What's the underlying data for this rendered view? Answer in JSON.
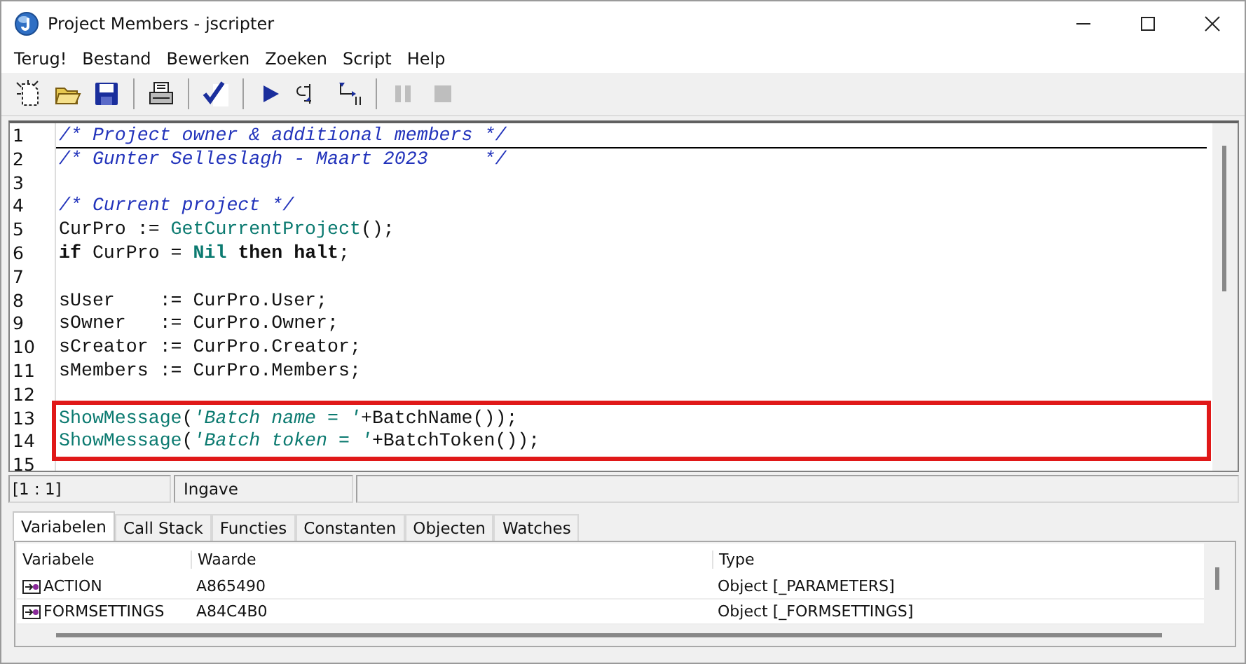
{
  "window": {
    "title": "Project Members - jscripter"
  },
  "menu": [
    "Terug!",
    "Bestand",
    "Bewerken",
    "Zoeken",
    "Script",
    "Help"
  ],
  "toolbar": {
    "groups": [
      [
        {
          "kind": "new",
          "disabled": false
        },
        {
          "kind": "open",
          "disabled": false
        },
        {
          "kind": "save",
          "disabled": false
        }
      ],
      [
        {
          "kind": "print",
          "disabled": false
        }
      ],
      [
        {
          "kind": "check",
          "disabled": false
        }
      ],
      [
        {
          "kind": "run",
          "disabled": false
        },
        {
          "kind": "step-into",
          "disabled": false
        },
        {
          "kind": "step-over",
          "disabled": false
        }
      ],
      [
        {
          "kind": "pause",
          "disabled": true
        },
        {
          "kind": "stop",
          "disabled": true
        }
      ]
    ]
  },
  "editor": {
    "lines": [
      {
        "number": "1",
        "current": true,
        "marked": false,
        "tokens": [
          {
            "kind": "comment",
            "text": "/* Project owner & additional members */"
          }
        ]
      },
      {
        "number": "2",
        "current": false,
        "marked": false,
        "tokens": [
          {
            "kind": "comment",
            "text": "/* Gunter Selleslagh - Maart 2023     */"
          }
        ]
      },
      {
        "number": "3",
        "current": false,
        "marked": false
      },
      {
        "number": "4",
        "current": false,
        "marked": false,
        "tokens": [
          {
            "kind": "comment",
            "text": "/* Current project */"
          }
        ]
      },
      {
        "number": "5",
        "current": false,
        "marked": false,
        "tokens": [
          {
            "kind": "text",
            "text": "CurPro := "
          },
          {
            "kind": "function",
            "text": "GetCurrentProject"
          },
          {
            "kind": "text",
            "text": "();"
          }
        ]
      },
      {
        "number": "6",
        "current": false,
        "marked": false,
        "tokens": [
          {
            "kind": "keyword",
            "text": "if"
          },
          {
            "kind": "text",
            "text": " CurPro = "
          },
          {
            "kind": "constant",
            "text": "Nil"
          },
          {
            "kind": "keyword",
            "text": " then"
          },
          {
            "kind": "keyword",
            "text": " halt"
          },
          {
            "kind": "text",
            "text": ";"
          }
        ]
      },
      {
        "number": "7",
        "current": false,
        "marked": false
      },
      {
        "number": "8",
        "current": false,
        "marked": false,
        "tokens": [
          {
            "kind": "text",
            "text": "sUser    := CurPro.User;"
          }
        ]
      },
      {
        "number": "9",
        "current": false,
        "marked": false,
        "tokens": [
          {
            "kind": "text",
            "text": "sOwner   := CurPro.Owner;"
          }
        ]
      },
      {
        "number": "10",
        "current": false,
        "marked": false,
        "tokens": [
          {
            "kind": "text",
            "text": "sCreator := CurPro.Creator;"
          }
        ]
      },
      {
        "number": "11",
        "current": false,
        "marked": false,
        "tokens": [
          {
            "kind": "text",
            "text": "sMembers := CurPro.Members;"
          }
        ]
      },
      {
        "number": "12",
        "current": false,
        "marked": false
      },
      {
        "number": "13",
        "current": false,
        "marked": true,
        "tokens": [
          {
            "kind": "function",
            "text": "ShowMessage"
          },
          {
            "kind": "text",
            "text": "("
          },
          {
            "kind": "string",
            "text": "'Batch name = '"
          },
          {
            "kind": "text",
            "text": "+BatchName());"
          }
        ]
      },
      {
        "number": "14",
        "current": false,
        "marked": true,
        "tokens": [
          {
            "kind": "function",
            "text": "ShowMessage"
          },
          {
            "kind": "text",
            "text": "("
          },
          {
            "kind": "string",
            "text": "'Batch token = '"
          },
          {
            "kind": "text",
            "text": "+BatchToken());"
          }
        ]
      },
      {
        "number": "15",
        "current": false,
        "marked": false
      }
    ]
  },
  "status_bar": {
    "position": "[1 : 1]",
    "mode": "Ingave"
  },
  "tabs": [
    {
      "label": "Variabelen",
      "selected": true
    },
    {
      "label": "Call Stack",
      "selected": false
    },
    {
      "label": "Functies",
      "selected": false
    },
    {
      "label": "Constanten",
      "selected": false
    },
    {
      "label": "Objecten",
      "selected": false
    },
    {
      "label": "Watches",
      "selected": false
    }
  ],
  "table": {
    "columns": [
      "Variabele",
      "Waarde",
      "Type"
    ],
    "rows": [
      [
        "ACTION",
        "A865490",
        "Object [_PARAMETERS]"
      ],
      [
        "FORMSETTINGS",
        "A84C4B0",
        "Object [_FORMSETTINGS]"
      ]
    ]
  }
}
